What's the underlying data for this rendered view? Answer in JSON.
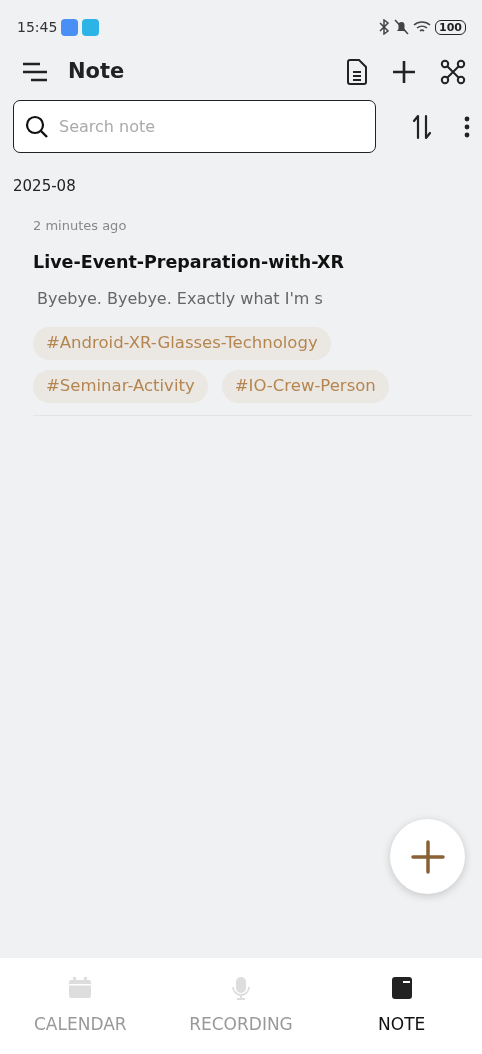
{
  "status_bar": {
    "time": "15:45",
    "battery": "100"
  },
  "header": {
    "title": "Note"
  },
  "search": {
    "placeholder": "Search note"
  },
  "groups": [
    {
      "date": "2025-08",
      "notes": [
        {
          "time": "2 minutes ago",
          "title": "Live-Event-Preparation-with-XR",
          "preview": "Byebye. Byebye. Exactly what I'm s",
          "tags": [
            "#Android-XR-Glasses-Technology",
            "#Seminar-Activity",
            "#IO-Crew-Person"
          ]
        }
      ]
    }
  ],
  "tabs": [
    {
      "label": "CALENDAR",
      "kind": "calendar",
      "selected": false
    },
    {
      "label": "RECORDING",
      "kind": "recording",
      "selected": false
    },
    {
      "label": "NOTE",
      "kind": "note",
      "selected": true
    }
  ]
}
